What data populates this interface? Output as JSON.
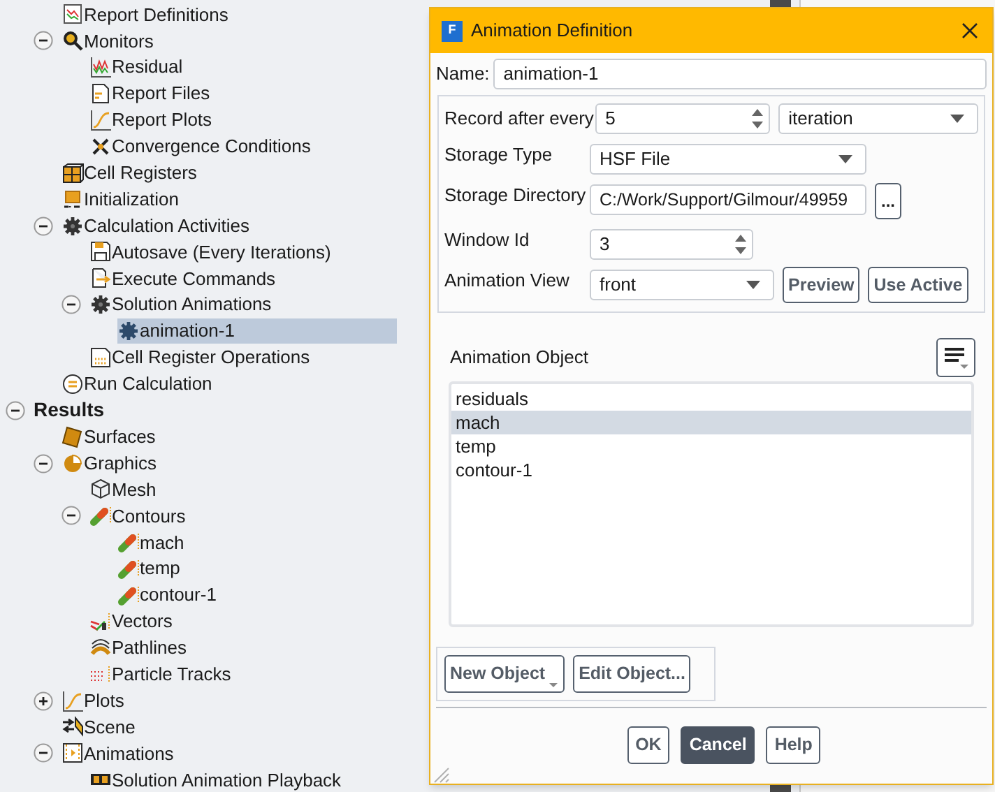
{
  "tree": {
    "continued_items": [
      {
        "label": "Report Definitions",
        "selected": false
      },
      {
        "label": "Monitors",
        "selected": false,
        "expanded": true,
        "children": [
          {
            "label": "Residual",
            "selected": false
          },
          {
            "label": "Report Files",
            "selected": false
          },
          {
            "label": "Report Plots",
            "selected": false
          },
          {
            "label": "Convergence Conditions",
            "selected": false
          }
        ]
      },
      {
        "label": "Cell Registers",
        "selected": false
      },
      {
        "label": "Initialization",
        "selected": false
      },
      {
        "label": "Calculation Activities",
        "selected": false,
        "expanded": true,
        "children": [
          {
            "label": "Autosave (Every Iterations)",
            "selected": false
          },
          {
            "label": "Execute Commands",
            "selected": false
          },
          {
            "label": "Solution Animations",
            "selected": false,
            "expanded": true,
            "children": [
              {
                "label": "animation-1",
                "selected": true
              }
            ]
          },
          {
            "label": "Cell Register Operations",
            "selected": false
          }
        ]
      },
      {
        "label": "Run Calculation",
        "selected": false
      }
    ],
    "items": [
      {
        "label": "Results",
        "selected": false,
        "expanded": true,
        "children": [
          {
            "label": "Surfaces",
            "selected": false
          },
          {
            "label": "Graphics",
            "selected": false,
            "expanded": true,
            "children": [
              {
                "label": "Mesh",
                "selected": false
              },
              {
                "label": "Contours",
                "selected": false,
                "expanded": true,
                "children": [
                  {
                    "label": "mach",
                    "selected": false
                  },
                  {
                    "label": "temp",
                    "selected": false
                  },
                  {
                    "label": "contour-1",
                    "selected": false
                  }
                ]
              },
              {
                "label": "Vectors",
                "selected": false
              },
              {
                "label": "Pathlines",
                "selected": false
              },
              {
                "label": "Particle Tracks",
                "selected": false
              }
            ]
          },
          {
            "label": "Plots",
            "selected": false,
            "expanded": false
          },
          {
            "label": "Scene",
            "selected": false
          },
          {
            "label": "Animations",
            "selected": false,
            "expanded": true,
            "children": [
              {
                "label": "Solution Animation Playback",
                "selected": false
              }
            ]
          }
        ]
      }
    ]
  },
  "dialog": {
    "icon_letter": "F",
    "title": "Animation Definition",
    "name": {
      "label": "Name:",
      "value": "animation-1"
    },
    "record": {
      "label": "Record after every",
      "value": "5",
      "unit": "iteration"
    },
    "storage_type": {
      "label": "Storage Type",
      "value": "HSF File"
    },
    "storage_directory": {
      "label": "Storage Directory",
      "value": "C:/Work/Support/Gilmour/49959",
      "browse": "..."
    },
    "window_id": {
      "label": "Window Id",
      "value": "3"
    },
    "animation_view": {
      "label": "Animation View",
      "value": "front",
      "buttons": [
        "Preview",
        "Use Active"
      ]
    },
    "animation_object": {
      "label": "Animation Object",
      "items": [
        {
          "label": "residuals",
          "selected": false
        },
        {
          "label": "mach",
          "selected": true
        },
        {
          "label": "temp",
          "selected": false
        },
        {
          "label": "contour-1",
          "selected": false
        }
      ]
    },
    "object_buttons": [
      {
        "label": "New Object",
        "menu": true
      },
      {
        "label": "Edit Object...",
        "menu": false
      }
    ],
    "buttons": [
      {
        "label": "OK",
        "default": false
      },
      {
        "label": "Cancel",
        "default": true
      },
      {
        "label": "Help",
        "default": false
      }
    ]
  }
}
